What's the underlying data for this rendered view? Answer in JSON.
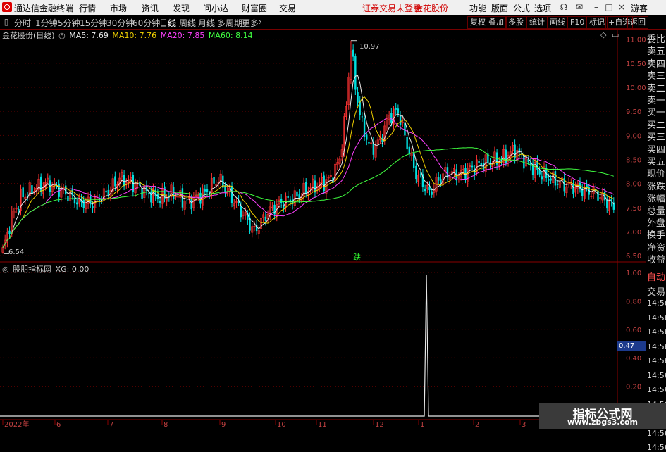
{
  "app": {
    "name": "通达信金融终端",
    "menu": [
      "行情",
      "市场",
      "资讯",
      "发现",
      "问小达",
      "财富圈",
      "交易"
    ],
    "status_text": "证券交易未登录",
    "stock_name": "金花股份",
    "right_menu": [
      "功能",
      "版面",
      "公式",
      "选项"
    ],
    "user": "游客"
  },
  "periods": {
    "items": [
      "分时",
      "1分钟",
      "5分钟",
      "15分钟",
      "30分钟",
      "60分钟",
      "日线",
      "周线",
      "月线",
      "多周期",
      "更多"
    ],
    "active": "日线"
  },
  "tools": [
    "复权",
    "叠加",
    "多股",
    "统计",
    "画线",
    "F10",
    "标记",
    "+自选",
    "返回"
  ],
  "main_chart": {
    "title": "金花股份(日线)",
    "ma": [
      {
        "label": "MA5: 7.69",
        "color": "#e8e8e8"
      },
      {
        "label": "MA10: 7.76",
        "color": "#f0d000"
      },
      {
        "label": "MA20: 7.85",
        "color": "#ff40ff"
      },
      {
        "label": "MA60: 8.14",
        "color": "#40ff40"
      }
    ],
    "high_label": "10.97",
    "low_label": "6.54",
    "signal_label": "跌",
    "axis_ticks": [
      "11.00",
      "10.50",
      "10.00",
      "9.50",
      "9.00",
      "8.50",
      "8.00",
      "7.50",
      "7.00",
      "6.50"
    ]
  },
  "sub_chart": {
    "title": "股朋指标网",
    "value": "XG: 0.00",
    "axis_ticks": [
      "1.00",
      "0.80",
      "0.60",
      "0.40",
      "0.20"
    ],
    "cursor_value": "0.47"
  },
  "x_axis": [
    "2022年",
    "6",
    "7",
    "8",
    "9",
    "10",
    "11",
    "12",
    "1",
    "2",
    "3"
  ],
  "right_panel": {
    "labels": [
      "委比",
      "卖五",
      "卖四",
      "卖三",
      "卖二",
      "卖一",
      "买一",
      "买二",
      "买三",
      "买四",
      "买五",
      "现价",
      "涨跌",
      "涨幅",
      "总量",
      "外盘",
      "换手",
      "净资",
      "收益",
      "自动",
      "交易",
      "14:56",
      "14:56",
      "14:56",
      "14:56",
      "14:56",
      "14:56",
      "14:56",
      "14:56",
      "14:56",
      "14:56",
      "14:56"
    ]
  },
  "watermark": {
    "main": "指标公式网",
    "sub": "www.zbgs3.com"
  },
  "chart_data": {
    "type": "candlestick",
    "title": "金花股份(日线)",
    "ylim": [
      6.4,
      11.2
    ],
    "high": 10.97,
    "low": 6.54,
    "x_ticks": [
      "2022年",
      "6",
      "7",
      "8",
      "9",
      "10",
      "11",
      "12",
      "1",
      "2",
      "3"
    ],
    "series": [
      {
        "name": "MA5",
        "last": 7.69
      },
      {
        "name": "MA10",
        "last": 7.76
      },
      {
        "name": "MA20",
        "last": 7.85
      },
      {
        "name": "MA60",
        "last": 8.14
      }
    ],
    "close_keyframes": [
      [
        0,
        6.6
      ],
      [
        4,
        7.3
      ],
      [
        8,
        7.7
      ],
      [
        14,
        7.9
      ],
      [
        20,
        8.0
      ],
      [
        28,
        7.8
      ],
      [
        34,
        7.6
      ],
      [
        40,
        7.6
      ],
      [
        46,
        7.8
      ],
      [
        52,
        8.1
      ],
      [
        58,
        8.0
      ],
      [
        64,
        7.8
      ],
      [
        70,
        7.7
      ],
      [
        76,
        7.8
      ],
      [
        82,
        7.6
      ],
      [
        90,
        7.8
      ],
      [
        96,
        8.1
      ],
      [
        102,
        7.7
      ],
      [
        108,
        7.3
      ],
      [
        112,
        7.0
      ],
      [
        118,
        7.4
      ],
      [
        124,
        7.6
      ],
      [
        130,
        7.7
      ],
      [
        136,
        7.9
      ],
      [
        142,
        8.0
      ],
      [
        146,
        8.1
      ],
      [
        150,
        8.5
      ],
      [
        153,
        9.6
      ],
      [
        155,
        10.9
      ],
      [
        157,
        10.0
      ],
      [
        160,
        9.2
      ],
      [
        164,
        8.7
      ],
      [
        168,
        8.9
      ],
      [
        172,
        9.4
      ],
      [
        176,
        9.5
      ],
      [
        180,
        8.8
      ],
      [
        184,
        8.2
      ],
      [
        190,
        7.8
      ],
      [
        196,
        8.2
      ],
      [
        204,
        8.2
      ],
      [
        212,
        8.4
      ],
      [
        222,
        8.5
      ],
      [
        228,
        8.7
      ],
      [
        234,
        8.4
      ],
      [
        240,
        8.2
      ],
      [
        248,
        8.0
      ],
      [
        256,
        7.9
      ],
      [
        264,
        7.8
      ],
      [
        272,
        7.5
      ]
    ],
    "indicator": {
      "name": "XG",
      "value": 0.0,
      "ylim": [
        0,
        1
      ],
      "spike": {
        "at_fraction": 0.69,
        "value": 1.0
      }
    }
  }
}
